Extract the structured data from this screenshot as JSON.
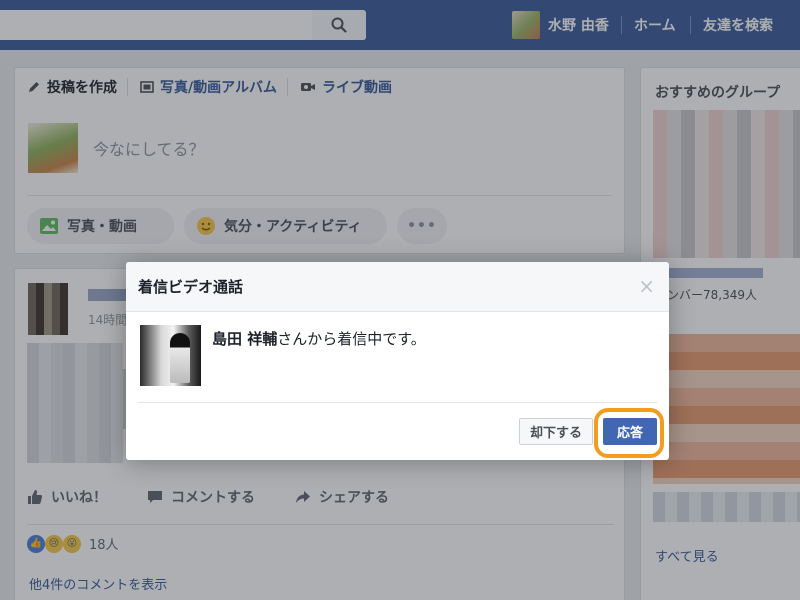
{
  "topbar": {
    "user_name": "水野 由香",
    "home": "ホーム",
    "find_friends": "友達を検索"
  },
  "composer": {
    "tabs": [
      "投稿を作成",
      "写真/動画アルバム",
      "ライブ動画"
    ],
    "placeholder": "今なにしてる？",
    "photo_video": "写真・動画",
    "feeling_activity": "気分・アクティビティ",
    "more": "•••"
  },
  "post": {
    "time": "14時間",
    "like": "いいね！",
    "comment": "コメントする",
    "share": "シェアする",
    "reaction_count": "18人",
    "more_comments": "他4件のコメントを表示"
  },
  "sidebar": {
    "title": "おすすめのグループ",
    "members": "メンバー78,349人",
    "see_all": "すべて見る"
  },
  "dialog": {
    "title": "着信ビデオ通話",
    "close": "×",
    "caller_name": "島田 祥輔",
    "caller_suffix": "さんから着信中です。",
    "decline": "却下する",
    "answer": "応答"
  },
  "colors": {
    "brand": "#3b5998",
    "primary_button": "#4267b2",
    "highlight": "#f39c1e"
  }
}
